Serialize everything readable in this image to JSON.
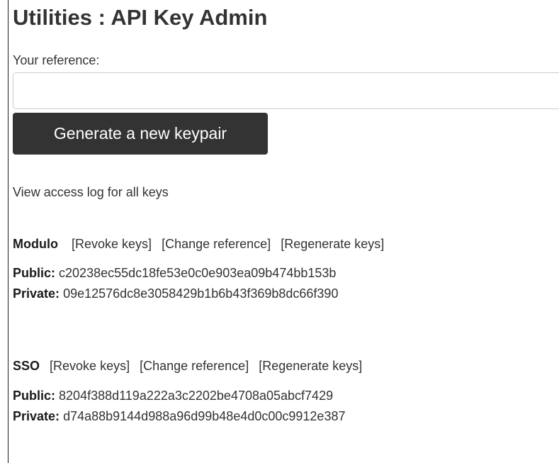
{
  "page": {
    "title": "Utilities : API Key Admin"
  },
  "reference": {
    "label": "Your reference:",
    "value": "",
    "placeholder": ""
  },
  "generate_button": {
    "label": "Generate a new keypair"
  },
  "access_log_link": {
    "label": "View access log for all keys"
  },
  "keys": [
    {
      "name": "Modulo",
      "revoke_label": "[Revoke keys]",
      "change_ref_label": "[Change reference]",
      "regen_label": "[Regenerate keys]",
      "public_label": "Public:",
      "public_value": "c20238ec55dc18fe53e0c0e903ea09b474bb153b",
      "private_label": "Private:",
      "private_value": "09e12576dc8e3058429b1b6b43f369b8dc66f390"
    },
    {
      "name": "SSO",
      "revoke_label": "[Revoke keys]",
      "change_ref_label": "[Change reference]",
      "regen_label": "[Regenerate keys]",
      "public_label": "Public:",
      "public_value": "8204f388d119a222a3c2202be4708a05abcf7429",
      "private_label": "Private:",
      "private_value": "d74a88b9144d988a96d99b48e4d0c00c9912e387"
    }
  ]
}
